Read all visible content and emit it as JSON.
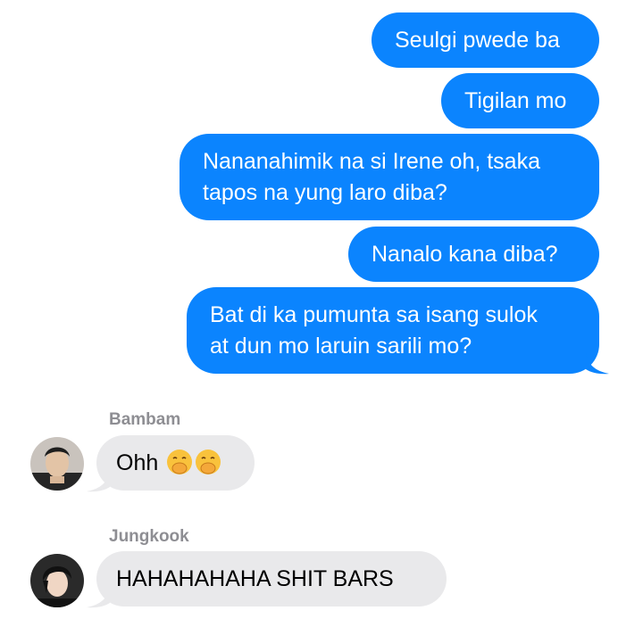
{
  "outgoing": [
    {
      "text": "Seulgi pwede ba"
    },
    {
      "text": "Tigilan mo"
    },
    {
      "line1": "Nananahimik na si Irene oh, tsaka",
      "line2": "tapos na yung laro diba?"
    },
    {
      "text": "Nanalo kana diba?"
    },
    {
      "line1": "Bat di ka pumunta sa isang sulok",
      "line2": "at dun mo laruin sarili mo?"
    }
  ],
  "incoming": [
    {
      "sender": "Bambam",
      "text": "Ohh",
      "emojis": [
        "face-with-hand-over-mouth-icon",
        "face-with-hand-over-mouth-icon"
      ]
    },
    {
      "sender": "Jungkook",
      "text": "HAHAHAHAHA SHIT BARS"
    }
  ],
  "colors": {
    "outgoing_bubble": "#0b84fe",
    "incoming_bubble": "#e9e9eb",
    "sender_name": "#8e8e93"
  }
}
